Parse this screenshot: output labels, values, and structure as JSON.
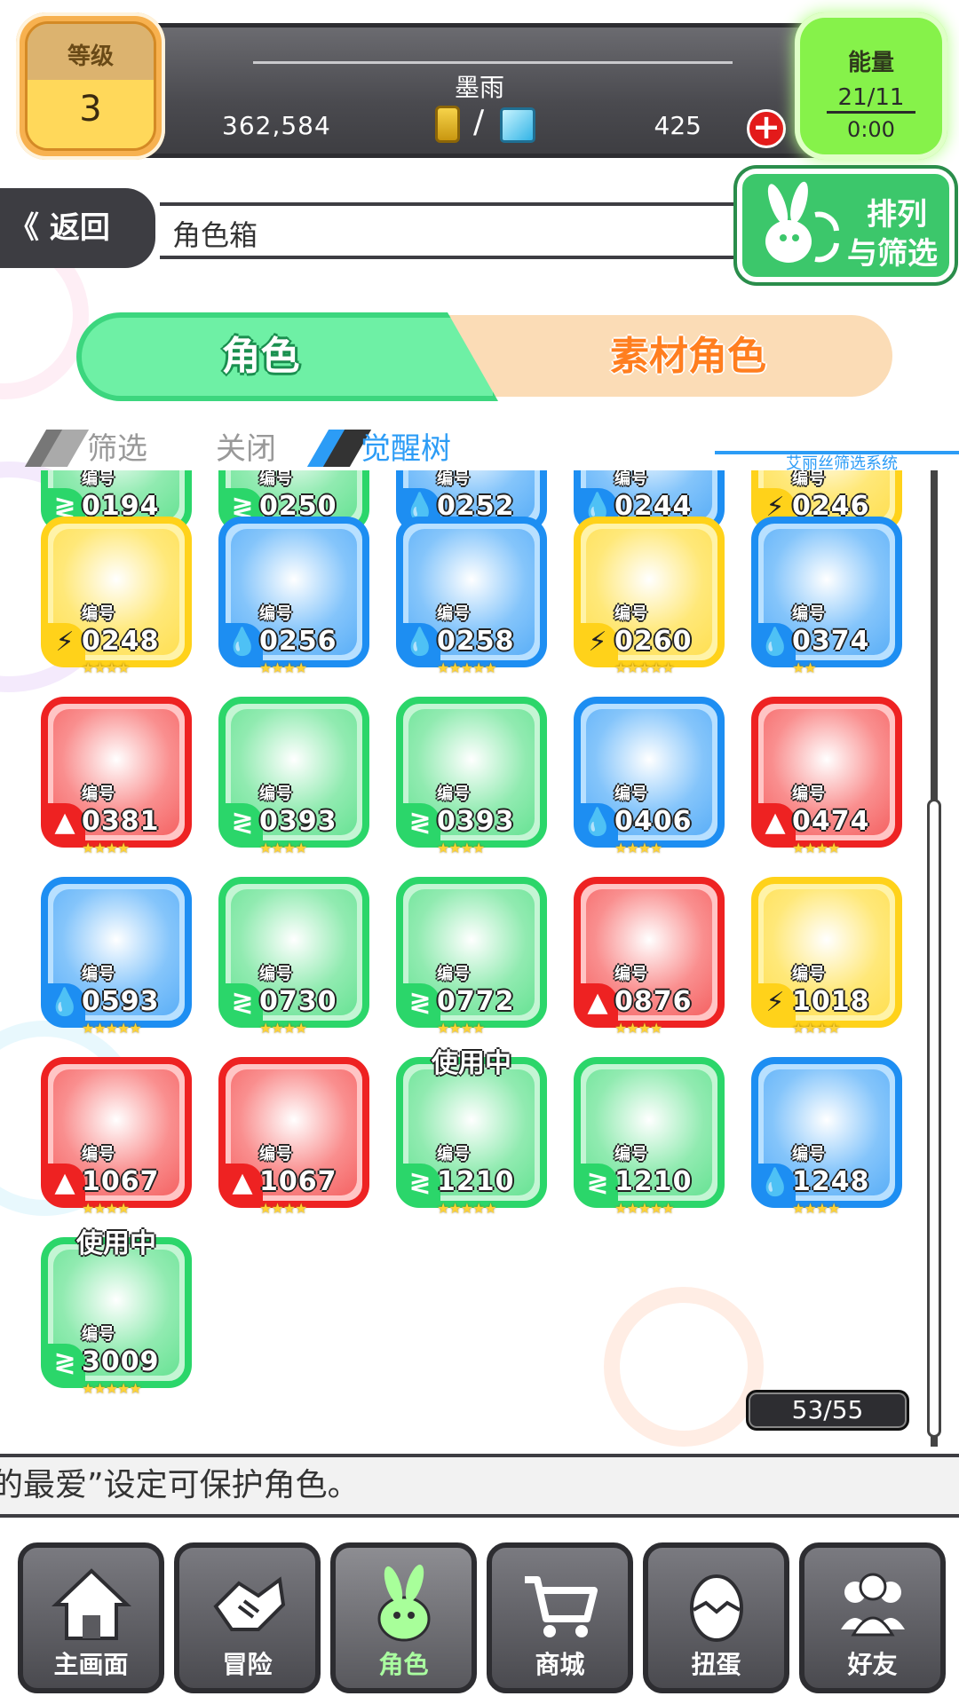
{
  "header": {
    "level_label": "等级",
    "level_value": "3",
    "player_name": "墨雨",
    "money": "362,584",
    "slash": "/",
    "gems": "425",
    "energy_label": "能量",
    "energy_value": "21/11",
    "energy_time": "0:00"
  },
  "nav": {
    "back_label": "返回",
    "page_title": "角色箱",
    "sort_line1": "排列",
    "sort_line2": "与筛选"
  },
  "tabs": {
    "characters": "角色",
    "materials": "素材角色"
  },
  "filter": {
    "filter_label": "筛选",
    "close_label": "关闭",
    "tree_label": "觉醒树",
    "alice_label": "艾丽丝筛选系统"
  },
  "grid": {
    "number_prefix": "编号",
    "in_use_label": "使用中",
    "partial_row": [
      "0194",
      "0250",
      "0252",
      "0244",
      "0246"
    ],
    "cards": [
      {
        "number": "0248",
        "element": "thunder",
        "color": "#ffd21a",
        "stars": "★★★★",
        "in_use": false
      },
      {
        "number": "0256",
        "element": "water",
        "color": "#1d8ef2",
        "stars": "★★★★",
        "in_use": false
      },
      {
        "number": "0258",
        "element": "water",
        "color": "#1d8ef2",
        "stars": "★★★★★",
        "in_use": false
      },
      {
        "number": "0260",
        "element": "thunder",
        "color": "#ffd21a",
        "stars": "★★★★★",
        "in_use": false
      },
      {
        "number": "0374",
        "element": "water",
        "color": "#1d8ef2",
        "stars": "★★",
        "in_use": false
      },
      {
        "number": "0381",
        "element": "fire",
        "color": "#ee2222",
        "stars": "★★★★",
        "in_use": false
      },
      {
        "number": "0393",
        "element": "wind",
        "color": "#2bd66a",
        "stars": "★★★★",
        "in_use": false
      },
      {
        "number": "0393",
        "element": "wind",
        "color": "#2bd66a",
        "stars": "★★★★",
        "in_use": false
      },
      {
        "number": "0406",
        "element": "water",
        "color": "#1d8ef2",
        "stars": "★★★★",
        "in_use": false
      },
      {
        "number": "0474",
        "element": "fire",
        "color": "#ee2222",
        "stars": "★★★★",
        "in_use": false
      },
      {
        "number": "0593",
        "element": "water",
        "color": "#1d8ef2",
        "stars": "★★★★★",
        "in_use": false
      },
      {
        "number": "0730",
        "element": "wind",
        "color": "#2bd66a",
        "stars": "★★★★",
        "in_use": false
      },
      {
        "number": "0772",
        "element": "wind",
        "color": "#2bd66a",
        "stars": "★★★★",
        "in_use": false
      },
      {
        "number": "0876",
        "element": "fire",
        "color": "#ee2222",
        "stars": "★★★★",
        "in_use": false
      },
      {
        "number": "1018",
        "element": "thunder",
        "color": "#ffd21a",
        "stars": "★★★★",
        "in_use": false
      },
      {
        "number": "1067",
        "element": "fire",
        "color": "#ee2222",
        "stars": "★★★★",
        "in_use": false
      },
      {
        "number": "1067",
        "element": "fire",
        "color": "#ee2222",
        "stars": "★★★★",
        "in_use": false
      },
      {
        "number": "1210",
        "element": "wind",
        "color": "#2bd66a",
        "stars": "★★★★★",
        "in_use": true
      },
      {
        "number": "1210",
        "element": "wind",
        "color": "#2bd66a",
        "stars": "★★★★★",
        "in_use": false
      },
      {
        "number": "1248",
        "element": "water",
        "color": "#1d8ef2",
        "stars": "★★★★",
        "in_use": false
      },
      {
        "number": "3009",
        "element": "wind",
        "color": "#2bd66a",
        "stars": "★★★★★",
        "in_use": true
      }
    ]
  },
  "page_count": "53/55",
  "tip": "的最爱”设定可保护角色。",
  "bottom_nav": [
    {
      "label": "主画面",
      "icon": "home-icon",
      "active": false
    },
    {
      "label": "冒险",
      "icon": "handshake-icon",
      "active": false
    },
    {
      "label": "角色",
      "icon": "rabbit-icon",
      "active": true
    },
    {
      "label": "商城",
      "icon": "cart-icon",
      "active": false
    },
    {
      "label": "扭蛋",
      "icon": "egg-icon",
      "active": false
    },
    {
      "label": "好友",
      "icon": "friends-icon",
      "active": false
    }
  ],
  "colors": {
    "thunder": "#ffd21a",
    "water": "#1d8ef2",
    "fire": "#ee2222",
    "wind": "#2bd66a",
    "accent_green": "#6ef0a5",
    "accent_orange": "#ff7e1f",
    "accent_blue": "#2c9cf6"
  }
}
